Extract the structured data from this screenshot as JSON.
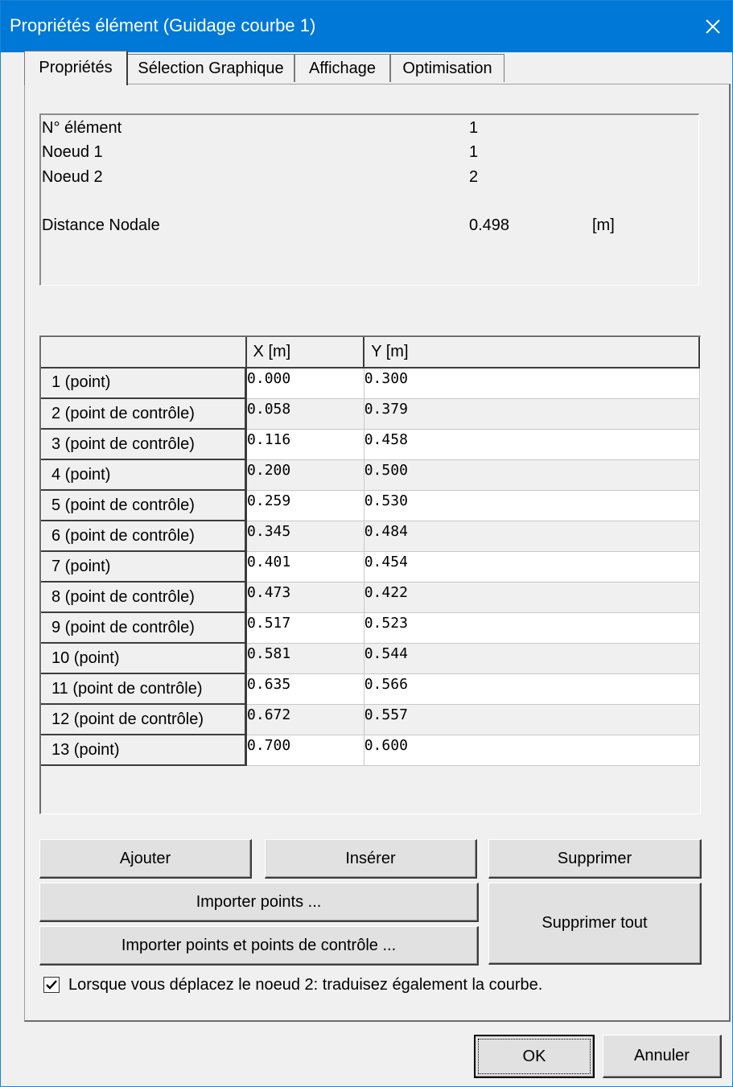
{
  "window": {
    "title": "Propriétés élément (Guidage courbe 1)"
  },
  "tabs": [
    {
      "label": "Propriétés",
      "active": true
    },
    {
      "label": "Sélection Graphique",
      "active": false
    },
    {
      "label": "Affichage",
      "active": false
    },
    {
      "label": "Optimisation",
      "active": false
    }
  ],
  "info": {
    "element_label": "N° élément",
    "element_value": "1",
    "node1_label": "Noeud 1",
    "node1_value": "1",
    "node2_label": "Noeud 2",
    "node2_value": "2",
    "distance_label": "Distance Nodale",
    "distance_value": "0.498",
    "distance_unit": "[m]"
  },
  "grid": {
    "columns": [
      "",
      "X [m]",
      "Y [m]"
    ],
    "rows": [
      {
        "label": "1 (point)",
        "x": "0.000",
        "y": "0.300"
      },
      {
        "label": "2 (point de contrôle)",
        "x": "0.058",
        "y": "0.379"
      },
      {
        "label": "3 (point de contrôle)",
        "x": "0.116",
        "y": "0.458"
      },
      {
        "label": "4 (point)",
        "x": "0.200",
        "y": "0.500"
      },
      {
        "label": "5 (point de contrôle)",
        "x": "0.259",
        "y": "0.530"
      },
      {
        "label": "6 (point de contrôle)",
        "x": "0.345",
        "y": "0.484"
      },
      {
        "label": "7 (point)",
        "x": "0.401",
        "y": "0.454"
      },
      {
        "label": "8 (point de contrôle)",
        "x": "0.473",
        "y": "0.422"
      },
      {
        "label": "9 (point de contrôle)",
        "x": "0.517",
        "y": "0.523"
      },
      {
        "label": "10 (point)",
        "x": "0.581",
        "y": "0.544"
      },
      {
        "label": "11 (point de contrôle)",
        "x": "0.635",
        "y": "0.566"
      },
      {
        "label": "12 (point de contrôle)",
        "x": "0.672",
        "y": "0.557"
      },
      {
        "label": "13 (point)",
        "x": "0.700",
        "y": "0.600"
      }
    ]
  },
  "buttons": {
    "add": "Ajouter",
    "insert": "Insérer",
    "delete": "Supprimer",
    "import_points": "Importer points ...",
    "import_points_ctrl": "Importer points et points de contrôle ...",
    "delete_all": "Supprimer tout",
    "ok": "OK",
    "cancel": "Annuler"
  },
  "checkbox": {
    "checked": true,
    "label": "Lorsque vous déplacez le noeud 2: traduisez également la courbe."
  },
  "colors": {
    "titlebar": "#0078d7",
    "dialog_bg": "#f0f0f0"
  }
}
